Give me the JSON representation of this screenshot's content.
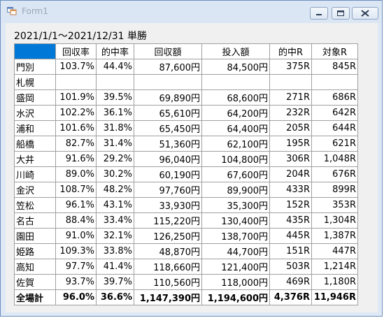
{
  "window": {
    "title": "Form1"
  },
  "header": "2021/1/1～2021/12/31 単勝",
  "table": {
    "columns": [
      "",
      "回収率",
      "的中率",
      "回収額",
      "投入額",
      "的中R",
      "対象R"
    ],
    "rows": [
      [
        "門別",
        "103.7%",
        "44.4%",
        "87,600円",
        "84,500円",
        "375R",
        "845R"
      ],
      [
        "札幌",
        "",
        "",
        "",
        "",
        "",
        ""
      ],
      [
        "盛岡",
        "101.9%",
        "39.5%",
        "69,890円",
        "68,600円",
        "271R",
        "686R"
      ],
      [
        "水沢",
        "102.2%",
        "36.1%",
        "65,610円",
        "64,200円",
        "232R",
        "642R"
      ],
      [
        "浦和",
        "101.6%",
        "31.8%",
        "65,450円",
        "64,400円",
        "205R",
        "644R"
      ],
      [
        "船橋",
        "82.7%",
        "31.4%",
        "51,360円",
        "62,100円",
        "195R",
        "621R"
      ],
      [
        "大井",
        "91.6%",
        "29.2%",
        "96,040円",
        "104,800円",
        "306R",
        "1,048R"
      ],
      [
        "川崎",
        "89.0%",
        "30.2%",
        "60,190円",
        "67,600円",
        "204R",
        "676R"
      ],
      [
        "金沢",
        "108.7%",
        "48.2%",
        "97,760円",
        "89,900円",
        "433R",
        "899R"
      ],
      [
        "笠松",
        "96.1%",
        "43.1%",
        "33,930円",
        "35,300円",
        "152R",
        "353R"
      ],
      [
        "名古",
        "88.4%",
        "33.4%",
        "115,220円",
        "130,400円",
        "435R",
        "1,304R"
      ],
      [
        "園田",
        "91.0%",
        "32.1%",
        "126,250円",
        "138,700円",
        "445R",
        "1,387R"
      ],
      [
        "姫路",
        "109.3%",
        "33.8%",
        "48,870円",
        "44,700円",
        "151R",
        "447R"
      ],
      [
        "高知",
        "97.7%",
        "41.4%",
        "118,660円",
        "121,400円",
        "503R",
        "1,214R"
      ],
      [
        "佐賀",
        "93.7%",
        "39.7%",
        "110,560円",
        "118,000円",
        "469R",
        "1,180R"
      ]
    ],
    "total": [
      "全場計",
      "96.0%",
      "36.6%",
      "1,147,390円",
      "1,194,600円",
      "4,376R",
      "11,946R"
    ]
  },
  "colors": {
    "selected_header": "#0078d7",
    "title_text": "#9aa7b8"
  }
}
